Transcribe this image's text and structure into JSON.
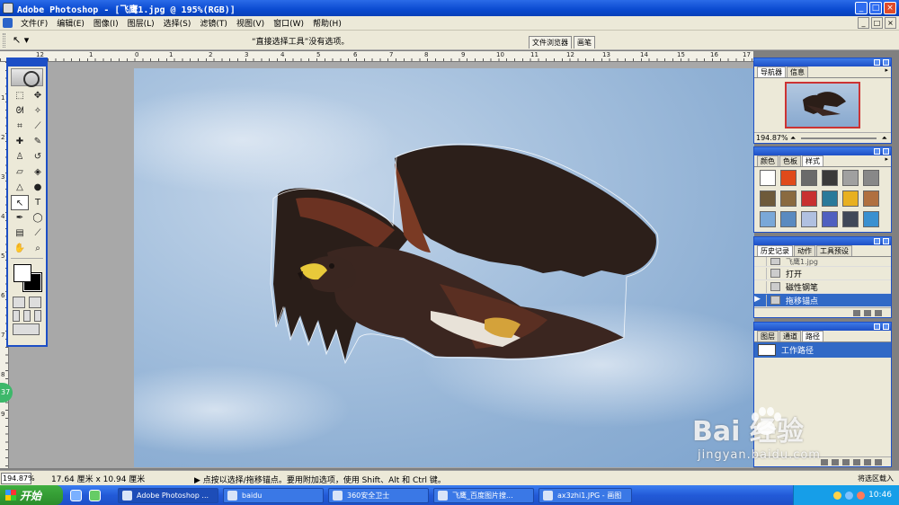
{
  "window": {
    "title": "Adobe Photoshop - [飞鹰1.jpg @ 195%(RGB)]",
    "min": "_",
    "max": "□",
    "close": "×"
  },
  "menu": [
    "文件(F)",
    "编辑(E)",
    "图像(I)",
    "图层(L)",
    "选择(S)",
    "滤镜(T)",
    "视图(V)",
    "窗口(W)",
    "帮助(H)"
  ],
  "options": {
    "text": "“直接选择工具”没有选项。",
    "well_tabs": [
      "文件浏览器",
      "画笔"
    ]
  },
  "rulers": {
    "top": [
      "12",
      "1",
      "0",
      "1",
      "2",
      "3",
      "4",
      "5",
      "6",
      "7",
      "8",
      "9",
      "10",
      "11",
      "12",
      "13",
      "14",
      "15",
      "16",
      "17"
    ],
    "left": [
      "1",
      "2",
      "3",
      "4",
      "5",
      "6",
      "7",
      "8",
      "9"
    ]
  },
  "navigator": {
    "tabs": [
      "导航器",
      "信息"
    ],
    "zoom": "194.87%"
  },
  "styles_palette": {
    "tabs": [
      "颜色",
      "色板",
      "样式"
    ],
    "swatches": [
      "#ffffff",
      "#e04a1a",
      "#6a6a6a",
      "#3a3a3a",
      "#a0a0a0",
      "#888888",
      "#6e5a3a",
      "#8a6a40",
      "#c83030",
      "#2a7a9a",
      "#e8b020",
      "#b07040",
      "#7aa8d8",
      "#5a8ac0",
      "#b0c0e0",
      "#5060c0",
      "#404858",
      "#3a90d0"
    ]
  },
  "history": {
    "tabs": [
      "历史记录",
      "动作",
      "工具预设"
    ],
    "snapshot": "飞鹰1.jpg",
    "items": [
      {
        "label": "打开",
        "selected": false
      },
      {
        "label": "磁性钢笔",
        "selected": false
      },
      {
        "label": "拖移锚点",
        "selected": true
      }
    ]
  },
  "paths": {
    "tabs": [
      "图层",
      "通道",
      "路径"
    ],
    "items": [
      "工作路径"
    ]
  },
  "status": {
    "zoom": "194.87%",
    "doc_size": "17.64 厘米 x 10.94 厘米",
    "hint": "▶  点按以选择/拖移锚点。要用附加选项，使用 Shift、Alt 和 Ctrl 键。",
    "right_hint": "将选区载入"
  },
  "taskbar": {
    "start": "开始",
    "items": [
      {
        "label": "Adobe Photoshop ...",
        "active": true
      },
      {
        "label": "baidu",
        "active": false
      },
      {
        "label": "360安全卫士",
        "active": false
      },
      {
        "label": "飞鹰_百度图片搜...",
        "active": false
      },
      {
        "label": "ax3zhi1.JPG - 画图",
        "active": false
      }
    ],
    "clock": "10:46"
  },
  "watermark": {
    "brand": "Bai  经验",
    "url": "jingyan.baidu.com"
  },
  "side_badge": "37",
  "colors": {
    "xp_blue": "#1d4fc6",
    "selection": "#3169c6",
    "canvas_bg": "#a8a8a8"
  }
}
